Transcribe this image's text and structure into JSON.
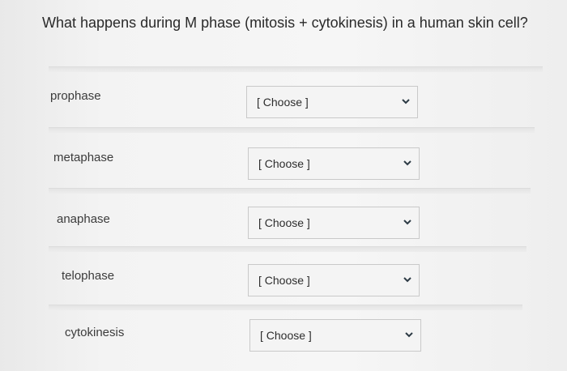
{
  "question": {
    "text": "What happens during M phase (mitosis + cytokinesis) in a human skin cell?"
  },
  "rows": [
    {
      "label": "prophase",
      "select_value": "[ Choose ]",
      "icon": "chevron-down-icon"
    },
    {
      "label": "metaphase",
      "select_value": "[ Choose ]",
      "icon": "chevron-down-icon"
    },
    {
      "label": "anaphase",
      "select_value": "[ Choose ]",
      "icon": "chevron-down-icon"
    },
    {
      "label": "telophase",
      "select_value": "[ Choose ]",
      "icon": "chevron-down-icon"
    },
    {
      "label": "cytokinesis",
      "select_value": "[ Choose ]",
      "icon": "chevron-down-icon"
    }
  ],
  "colors": {
    "page_background": "#f3f3f3",
    "divider": "#e6e6e6",
    "select_border": "#c9c9c9",
    "text": "#2a2a2a"
  }
}
